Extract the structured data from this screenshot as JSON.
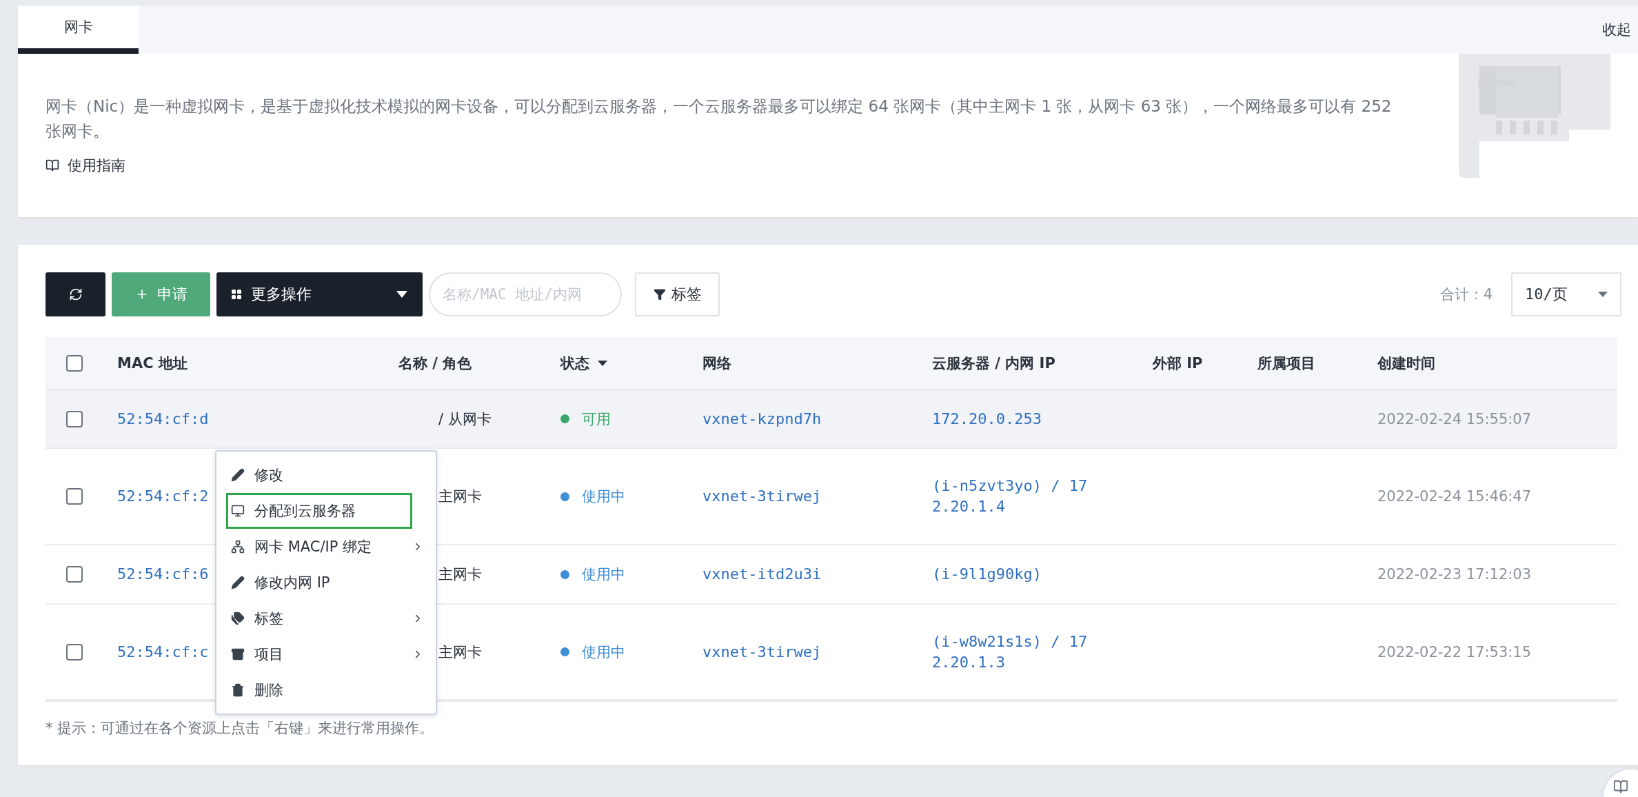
{
  "tabs": [
    {
      "label": "网卡",
      "selected": true
    }
  ],
  "collapse": "收起",
  "intro": {
    "text": "网卡（Nic）是一种虚拟网卡，是基于虚拟化技术模拟的网卡设备，可以分配到云服务器，一个云服务器最多可以绑定 64 张网卡（其中主网卡 1 张，从网卡 63 张），一个网络最多可以有 252 张网卡。",
    "guide": "使用指南"
  },
  "toolbar": {
    "apply": "申请",
    "more": "更多操作",
    "search": {
      "placeholder": "名称/MAC 地址/内网"
    },
    "tags": "标签",
    "total": "合计：4",
    "page_size": "10/页"
  },
  "table": {
    "header_checked": false,
    "columns": [
      "MAC 地址",
      "名称 / 角色",
      "状态",
      "网络",
      "云服务器 / 内网 IP",
      "外部 IP",
      "所属项目",
      "创建时间"
    ],
    "rows": [
      {
        "checked": false,
        "selected": true,
        "mac": "52:54:cf:d",
        "name": "/ 从网卡",
        "status": "可用",
        "color": "#3aa66a",
        "network": "vxnet-kzpnd7h",
        "server": "172.20.0.253",
        "created": "2022-02-24 15:55:07"
      },
      {
        "checked": false,
        "selected": false,
        "mac": "52:54:cf:2",
        "name": "主网卡",
        "status": "使用中",
        "color": "#3e8ed6",
        "network": "vxnet-3tirwej",
        "server": "(i-n5zvt3yo) / 172.20.1.4",
        "created": "2022-02-24 15:46:47"
      },
      {
        "checked": false,
        "selected": false,
        "mac": "52:54:cf:6",
        "name": "主网卡",
        "status": "使用中",
        "color": "#3e8ed6",
        "network": "vxnet-itd2u3i",
        "server": "(i-9l1g90kg)",
        "created": "2022-02-23 17:12:03"
      },
      {
        "checked": false,
        "selected": false,
        "mac": "52:54:cf:c",
        "name": "主网卡",
        "status": "使用中",
        "color": "#3e8ed6",
        "network": "vxnet-3tirwej",
        "server": "(i-w8w21s1s) / 172.20.1.3",
        "created": "2022-02-22 17:53:15"
      }
    ]
  },
  "context_menu": [
    {
      "kind": "edit",
      "label": "修改",
      "selected": false,
      "submenu": false
    },
    {
      "kind": "assign",
      "label": "分配到云服务器",
      "selected": true,
      "submenu": false
    },
    {
      "kind": "bind",
      "label": "网卡 MAC/IP 绑定",
      "selected": false,
      "submenu": true
    },
    {
      "kind": "edit",
      "label": "修改内网 IP",
      "selected": false,
      "submenu": false
    },
    {
      "kind": "tag",
      "label": "标签",
      "selected": false,
      "submenu": true
    },
    {
      "kind": "project",
      "label": "项目",
      "selected": false,
      "submenu": true
    },
    {
      "kind": "delete",
      "label": "删除",
      "selected": false,
      "submenu": false
    }
  ],
  "hint": "* 提示：可通过在各个资源上点击「右键」来进行常用操作。"
}
